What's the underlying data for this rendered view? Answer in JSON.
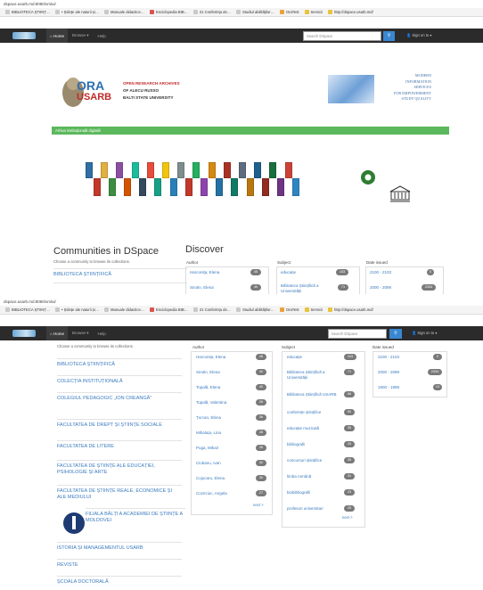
{
  "browser1": {
    "url": "dspace.usarb.md:8080/xmlui/"
  },
  "browser2": {
    "url": "dspace.usarb.md:8080/xmlui/"
  },
  "bookmarks": [
    "BIBLIOTECA ȘTIINȚ…",
    "• Științe ale naturii și…",
    "Manuale didactice…",
    "Enciclopedia BIB…",
    "21 Conferința de…",
    "Studiul abilităților…",
    "OraTest",
    "Servicii",
    "http://dspace.usarb.md/"
  ],
  "navbar": {
    "brand": "DSpace",
    "home": "Home",
    "browse": "Browse ▾",
    "help": "Help",
    "search_placeholder": "Search DSpace",
    "signin": "Sign on to ▾"
  },
  "header": {
    "logo_text": "ORA USARB",
    "logo_lines": [
      "OPEN RESEARCH ARCHIVES",
      "OF ALECU RUSSO",
      "BALTI STATE UNIVERSITY"
    ],
    "right_lines": [
      "MODERN",
      "INFORMATION",
      "SERVICES",
      "FOR EMPOWERMENT",
      "STUDY QUALITY"
    ]
  },
  "alert": "Arhiva instituțională digitală",
  "communities": {
    "title": "Communities in DSpace",
    "subtitle": "Choose a community to browse its collections.",
    "items": [
      "BIBLIOTECA ȘTIINȚIFICĂ",
      "COLECȚIA INSTITUȚIONALĂ",
      "COLEGIUL PEDAGOGIC „ION CREANGĂ”",
      "FACULTATEA DE DREPT ȘI ȘTIINȚE SOCIALE",
      "FACULTATEA DE LITERE",
      "FACULTATEA DE ȘTIINȚE ALE EDUCAȚIEI, PSIHOLOGIE ȘI ARTE",
      "FACULTATEA DE ȘTIINȚE REALE, ECONOMICE ȘI ALE MEDIULUI",
      "FILIALA BĂLȚI A ACADEMIEI DE ȘTIINȚE A MOLDOVEI",
      "ISTORIA ȘI MANAGEMENTUL USARB",
      "REVISTE",
      "ȘCOALA DOCTORALĂ"
    ]
  },
  "discover": {
    "title": "Discover",
    "author_title": "Author",
    "subject_title": "Subject",
    "date_title": "Date issued",
    "authors": [
      {
        "name": "Harconița, Elena",
        "count": "45"
      },
      {
        "name": "Sirotin, Elena",
        "count": "40"
      },
      {
        "name": "Topală, Elena",
        "count": "40"
      },
      {
        "name": "Topală, Valentina",
        "count": "39"
      },
      {
        "name": "Țurcan, Elena",
        "count": "36"
      },
      {
        "name": "Mihaluța, Lina",
        "count": "35"
      },
      {
        "name": "Puga, Mihail",
        "count": "35"
      },
      {
        "name": "Ciobanu, Ivan",
        "count": "32"
      },
      {
        "name": "Cojocaru, Elena",
        "count": "30"
      },
      {
        "name": "Cozirciuc, Angela",
        "count": "27"
      }
    ],
    "subjects": [
      {
        "name": "educație",
        "count": "103"
      },
      {
        "name": "Biblioteca Științifică a Universității",
        "count": "71"
      },
      {
        "name": "Biblioteca Științifică USARB",
        "count": "66"
      },
      {
        "name": "conferințe științifice",
        "count": "50"
      },
      {
        "name": "educație muzicală",
        "count": "35"
      },
      {
        "name": "bibliografii",
        "count": "33"
      },
      {
        "name": "concursuri științifice",
        "count": "35"
      },
      {
        "name": "limba română",
        "count": "31"
      },
      {
        "name": "biobibliografii",
        "count": "23"
      },
      {
        "name": "profesori universitari",
        "count": "25"
      }
    ],
    "dates": [
      {
        "name": "2100 - 2103",
        "count": "0"
      },
      {
        "name": "2000 - 2099",
        "count": "2334"
      },
      {
        "name": "1900 - 1999",
        "count": "13"
      }
    ],
    "more": "next >",
    "more2": "next >"
  }
}
